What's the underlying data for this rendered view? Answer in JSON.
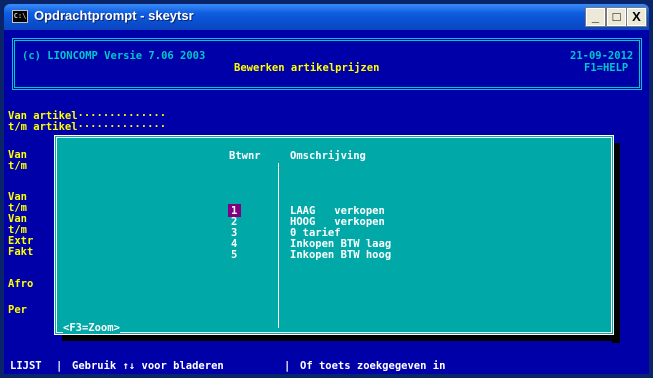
{
  "window": {
    "title": "Opdrachtprompt - skeytsr",
    "icon_label": "C:\\",
    "min_glyph": "_",
    "max_glyph": "□",
    "close_glyph": "X"
  },
  "header": {
    "copyright": "(c) LIONCOMP Versie 7.06 2003",
    "date": "21-09-2012",
    "screen_title": "Bewerken artikelprijzen",
    "help": "F1=HELP"
  },
  "form": {
    "van_artikel": "Van artikel··············",
    "tm_artikel": "t/m artikel··············",
    "labels": [
      "Van",
      "t/m",
      "Van",
      "t/m",
      "Van",
      "t/m",
      "Extr",
      "Fakt",
      "Afro",
      "Per"
    ]
  },
  "popup": {
    "col_btwnr": "Btwnr",
    "col_omschrijving": "Omschrijving",
    "rows": [
      {
        "nr": "1",
        "desc": "LAAG   verkopen"
      },
      {
        "nr": "2",
        "desc": "HOOG   verkopen"
      },
      {
        "nr": "3",
        "desc": "0 tarief"
      },
      {
        "nr": "4",
        "desc": "Inkopen BTW laag"
      },
      {
        "nr": "5",
        "desc": "Inkopen BTW hoog"
      }
    ],
    "footer": "<F3=Zoom>"
  },
  "status": {
    "mode": "LIJST",
    "nav": "Gebruik ↑↓ voor bladeren",
    "search": "Of toets zoekgegeven in"
  },
  "colors": {
    "console_bg": "#0000a8",
    "popup_bg": "#00a8a8",
    "selection": "#800080",
    "label_yellow": "#ffff00",
    "frame_cyan": "#00c8c8"
  }
}
